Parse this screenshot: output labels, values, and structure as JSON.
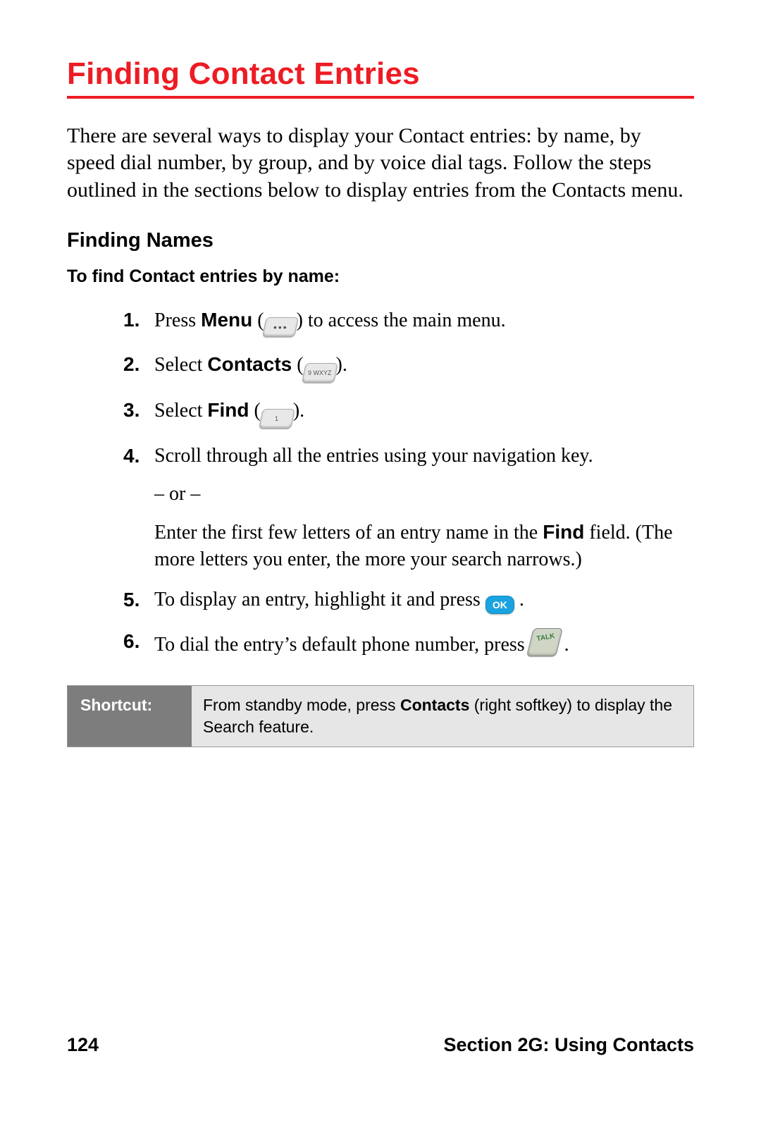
{
  "title": "Finding Contact Entries",
  "intro": "There are several ways to display your Contact entries: by name, by speed dial number, by group, and by voice dial tags. Follow the steps outlined in the sections below to display entries from the Contacts menu.",
  "subheading": "Finding Names",
  "procedure_heading": "To find Contact entries by name:",
  "steps": {
    "s1_a": "Press ",
    "s1_b": "Menu",
    "s1_c": " to access the main menu.",
    "s2_a": "Select ",
    "s2_b": "Contacts",
    "s3_a": "Select ",
    "s3_b": "Find",
    "s4": "Scroll through all the entries using your navigation key.",
    "s4_or": "– or –",
    "s4_alt_a": "Enter the first few letters of an entry name in the ",
    "s4_alt_b": "Find",
    "s4_alt_c": " field. (The more letters you enter, the more your search narrows.)",
    "s5_a": "To display an entry, highlight it and press ",
    "s6_a": "To dial the entry’s default phone number, press "
  },
  "icons": {
    "menu_key": "menu-key",
    "nine_key": "9 WXYZ",
    "one_key": "1",
    "ok": "OK",
    "talk": "TALK"
  },
  "shortcut": {
    "label": "Shortcut:",
    "body_a": "From standby mode, press ",
    "body_b": "Contacts",
    "body_c": " (right softkey) to display the Search feature."
  },
  "footer": {
    "page": "124",
    "section": "Section 2G: Using Contacts"
  }
}
